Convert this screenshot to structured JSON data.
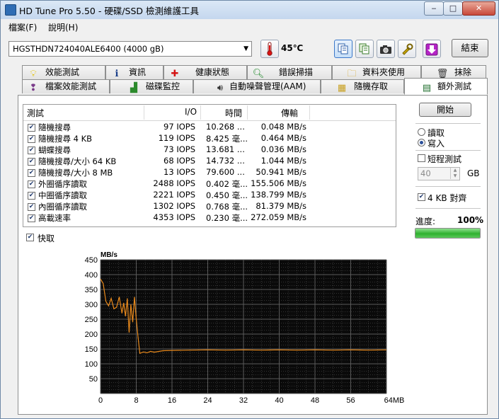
{
  "window": {
    "title": "HD Tune Pro 5.50 - 硬碟/SSD 檢測維護工具",
    "controls": {
      "minimize": "‒",
      "maximize": "□",
      "close": "✕"
    }
  },
  "menu": {
    "items": [
      "檔案(F)",
      "說明(H)"
    ]
  },
  "toolbar": {
    "drive": "HGSTHDN724040ALE6400 (4000 gB)",
    "temperature": "45℃",
    "exit_label": "結束"
  },
  "tabs": {
    "row1": [
      "效能測試",
      "資訊",
      "健康狀態",
      "錯誤掃描",
      "資料夾使用",
      "抹除"
    ],
    "row2": [
      "檔案效能測試",
      "磁碟監控",
      "自動噪聲管理(AAM)",
      "隨機存取",
      "額外測試"
    ]
  },
  "grid": {
    "headers": {
      "test": "測試",
      "io": "I/O",
      "time": "時間",
      "rate": "傳輸"
    },
    "rows": [
      {
        "checked": true,
        "test": "隨機搜尋",
        "io": "97 IOPS",
        "time": "10.268 ...",
        "rate": "0.048 MB/s"
      },
      {
        "checked": true,
        "test": "隨機搜尋 4 KB",
        "io": "119 IOPS",
        "time": "8.425 毫...",
        "rate": "0.464 MB/s"
      },
      {
        "checked": true,
        "test": "蝴蝶搜尋",
        "io": "73 IOPS",
        "time": "13.681 ...",
        "rate": "0.036 MB/s"
      },
      {
        "checked": true,
        "test": "隨機搜尋/大小 64 KB",
        "io": "68 IOPS",
        "time": "14.732 ...",
        "rate": "1.044 MB/s"
      },
      {
        "checked": true,
        "test": "隨機搜尋/大小 8 MB",
        "io": "13 IOPS",
        "time": "79.600 ...",
        "rate": "50.941 MB/s"
      },
      {
        "checked": true,
        "test": "外圈循序讀取",
        "io": "2488 IOPS",
        "time": "0.402 毫...",
        "rate": "155.506 MB/s"
      },
      {
        "checked": true,
        "test": "中圈循序讀取",
        "io": "2221 IOPS",
        "time": "0.450 毫...",
        "rate": "138.799 MB/s"
      },
      {
        "checked": true,
        "test": "內圈循序讀取",
        "io": "1302 IOPS",
        "time": "0.768 毫...",
        "rate": "81.379 MB/s"
      },
      {
        "checked": true,
        "test": "高載速率",
        "io": "4353 IOPS",
        "time": "0.230 毫...",
        "rate": "272.059 MB/s"
      }
    ]
  },
  "cache": {
    "label": "快取",
    "checked": true
  },
  "side": {
    "start_label": "開始",
    "read_label": "讀取",
    "write_label": "寫入",
    "mode": "write",
    "short_test_label": "短程測試",
    "short_test_checked": false,
    "size_value": "40",
    "size_unit": "GB",
    "align_label": "4 KB 對齊",
    "align_checked": true,
    "progress_label": "進度:",
    "progress_value": "100%",
    "progress_fraction": 1.0
  },
  "chart_data": {
    "type": "line",
    "ylabel": "MB/s",
    "xlabel": "MB",
    "ylim": [
      0,
      450
    ],
    "xlim": [
      0,
      64
    ],
    "y_ticks": [
      50,
      100,
      150,
      200,
      250,
      300,
      350,
      400,
      450
    ],
    "x_ticks": [
      0,
      8,
      16,
      24,
      32,
      40,
      48,
      56,
      64
    ],
    "x_tick_labels": [
      "0",
      "8",
      "16",
      "24",
      "32",
      "40",
      "48",
      "56",
      "64MB"
    ],
    "grid": true,
    "background": "#0a0a0a",
    "gridcolor": "#5a5a5a",
    "series": [
      {
        "color": "#e8891c",
        "x": [
          0,
          0.6,
          1.2,
          1.8,
          2.4,
          3.0,
          3.6,
          4.2,
          4.8,
          5.2,
          5.6,
          6.0,
          6.4,
          6.8,
          7.2,
          7.6,
          8.0,
          8.4,
          8.8,
          9.6,
          10.4,
          11.2,
          12,
          14,
          16,
          20,
          24,
          28,
          32,
          36,
          40,
          44,
          48,
          52,
          56,
          60,
          64
        ],
        "y": [
          385,
          370,
          310,
          295,
          320,
          285,
          290,
          325,
          270,
          305,
          260,
          320,
          205,
          300,
          240,
          325,
          250,
          190,
          135,
          140,
          137,
          142,
          139,
          144,
          145,
          146,
          147,
          146,
          147,
          146,
          147,
          146,
          147,
          146,
          147,
          146,
          147
        ]
      }
    ]
  }
}
